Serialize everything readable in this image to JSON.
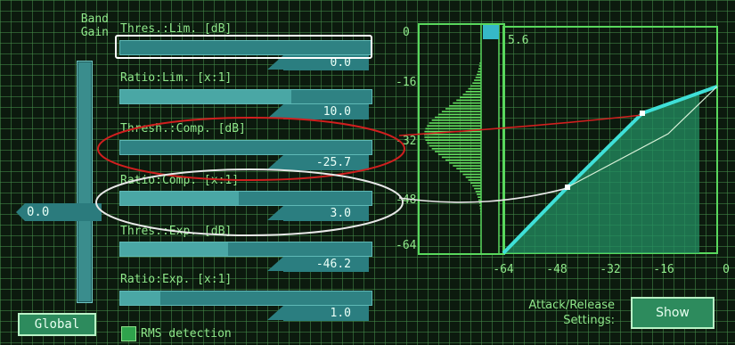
{
  "band_gain": {
    "label_line1": "Band",
    "label_line2": "Gain",
    "value": "0.0"
  },
  "params": [
    {
      "label": "Thres.:Lim. [dB]",
      "value": "0.0",
      "fill": 0.0
    },
    {
      "label": "Ratio:Lim. [x:1]",
      "value": "10.0",
      "fill": 0.68
    },
    {
      "label": "Thresh.:Comp. [dB]",
      "value": "-25.7",
      "fill": 0.0
    },
    {
      "label": "Ratio:Comp. [x:1]",
      "value": "3.0",
      "fill": 0.47
    },
    {
      "label": "Thres.:Exp. [dB]",
      "value": "-46.2",
      "fill": 0.43
    },
    {
      "label": "Ratio:Exp. [x:1]",
      "value": "1.0",
      "fill": 0.16
    }
  ],
  "meter": {
    "y_ticks": [
      "0",
      "-16",
      "-32",
      "-48",
      "-64"
    ],
    "readout": "5.6"
  },
  "transfer": {
    "x_ticks": [
      "-64",
      "-48",
      "-32",
      "-16",
      "0"
    ]
  },
  "buttons": {
    "global": "Global",
    "show": "Show"
  },
  "rms": {
    "label": "RMS detection"
  },
  "attack_release": {
    "line1": "Attack/Release",
    "line2": "Settings:"
  },
  "colors": {
    "accent": "#3fe0d8",
    "grid": "#46a04b",
    "panel": "#0c1a0e",
    "highlight_red": "#d11f1f",
    "highlight_white": "#e8e8e8"
  }
}
